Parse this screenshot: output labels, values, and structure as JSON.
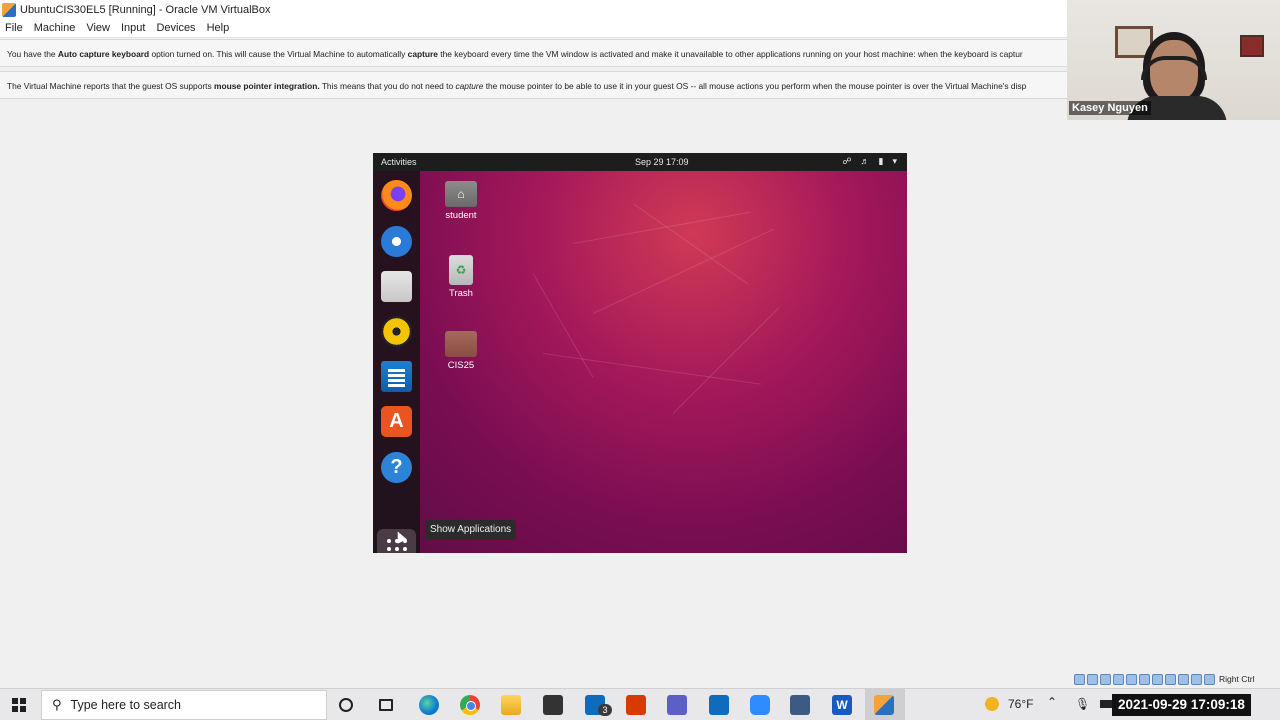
{
  "window": {
    "title": "UbuntuCIS30EL5 [Running] - Oracle VM VirtualBox"
  },
  "menubar": {
    "items": [
      "File",
      "Machine",
      "View",
      "Input",
      "Devices",
      "Help"
    ]
  },
  "notices": {
    "keyboard": {
      "t1": "You have the ",
      "b1": "Auto capture keyboard",
      "t2": " option turned on. This will cause the Virtual Machine to automatically ",
      "b2": "capture",
      "t3": " the keyboard every time the VM window is activated and make it unavailable to other applications running on your host machine: when the keyboard is captur"
    },
    "mouse": {
      "t1": "The Virtual Machine reports that the guest OS supports ",
      "b1": "mouse pointer integration.",
      "t2": " This means that you do not need to ",
      "i1": "capture",
      "t3": " the mouse pointer to be able to use it in your guest OS -- all mouse actions you perform when the mouse pointer is over the Virtual Machine's disp"
    }
  },
  "webcam": {
    "name": "Kasey Nguyen"
  },
  "ubuntu": {
    "topbar": {
      "activities": "Activities",
      "clock": "Sep 29  17:09"
    },
    "dock_tooltip": "Show Applications",
    "desktop_icons": {
      "home": "student",
      "trash": "Trash",
      "folder": "CIS25"
    }
  },
  "taskbar": {
    "search_placeholder": "Type here to search",
    "mail_badge": "3",
    "weather": "76°F",
    "datetime": "2021-09-29 17:09:18",
    "host_key": "Right Ctrl"
  },
  "colors": {
    "ubuntu_purple": "#7a0d52",
    "ubuntu_orange": "#e95420"
  }
}
